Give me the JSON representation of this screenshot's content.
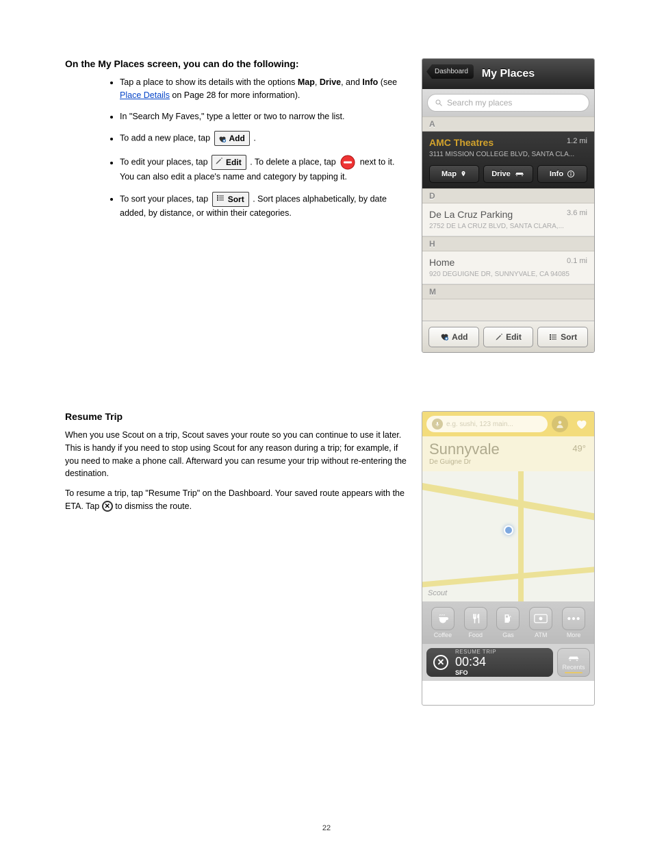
{
  "sections": {
    "s1": {
      "title": "On the My Places screen, you can do the following:",
      "bullets": [
        {
          "pre": "Tap a place to show its details with the options ",
          "bold1": "Map",
          "mid1": ", ",
          "bold2": "Drive",
          "mid2": ", and ",
          "bold3": "Info",
          "post": " (see ",
          "link": "Place Details",
          "link_after": " on Page 28 for more information)."
        },
        {
          "text": "In \"Search My Faves,\" type a letter or two to narrow the list."
        },
        {
          "pre": "To add a new place, tap ",
          "btn": "Add",
          "post": "."
        },
        {
          "pre": "To edit your places, tap ",
          "btn": "Edit",
          "mid": ". To delete a place, tap ",
          "icon_after": " next to it. You can also edit a place's name and category by tapping it."
        },
        {
          "pre": "To sort your places, tap ",
          "btn": "Sort",
          "post": ". Sort places alphabetically, by date added, by distance, or within their categories."
        }
      ]
    },
    "s2": {
      "title": "Resume Trip",
      "p1": "When you use Scout on a trip, Scout saves your route so you can continue to use it later. This is handy if you need to stop using Scout for any reason during a trip; for example, if you need to make a phone call. Afterward you can resume your trip without re-entering the destination.",
      "p2_pre": "To resume a trip, tap \"Resume Trip\" on the Dashboard. Your saved route appears with the ETA. Tap ",
      "p2_icon_label": "X",
      "p2_post": " to dismiss the route."
    }
  },
  "buttons": {
    "add": "Add",
    "edit": "Edit",
    "sort": "Sort"
  },
  "phone1": {
    "back": "Dashboard",
    "title": "My Places",
    "search_placeholder": "Search my places",
    "sections": {
      "A": "A",
      "D": "D",
      "H": "H",
      "M": "M"
    },
    "rowA": {
      "name": "AMC Theatres",
      "dist": "1.2 mi",
      "addr": "3111 MISSION COLLEGE BLVD, SANTA CLA...",
      "btn_map": "Map",
      "btn_drive": "Drive",
      "btn_info": "Info"
    },
    "rowD": {
      "name": "De La Cruz Parking",
      "dist": "3.6 mi",
      "addr": "2752 DE LA CRUZ BLVD, SANTA CLARA,..."
    },
    "rowH": {
      "name": "Home",
      "dist": "0.1 mi",
      "addr": "920 DEGUIGNE DR, SUNNYVALE, CA 94085"
    },
    "footer": {
      "add": "Add",
      "edit": "Edit",
      "sort": "Sort"
    }
  },
  "phone2": {
    "search_placeholder": "e.g. sushi, 123 main...",
    "loc_name": "Sunnyvale",
    "loc_sub": "De Guigne Dr",
    "temp": "49°",
    "scout": "Scout",
    "quick": {
      "coffee": "Coffee",
      "food": "Food",
      "gas": "Gas",
      "atm": "ATM",
      "more": "More"
    },
    "resume": {
      "label": "RESUME TRIP",
      "time": "00:34",
      "dest": "SFO"
    },
    "recents": "Recents"
  },
  "page": "22"
}
